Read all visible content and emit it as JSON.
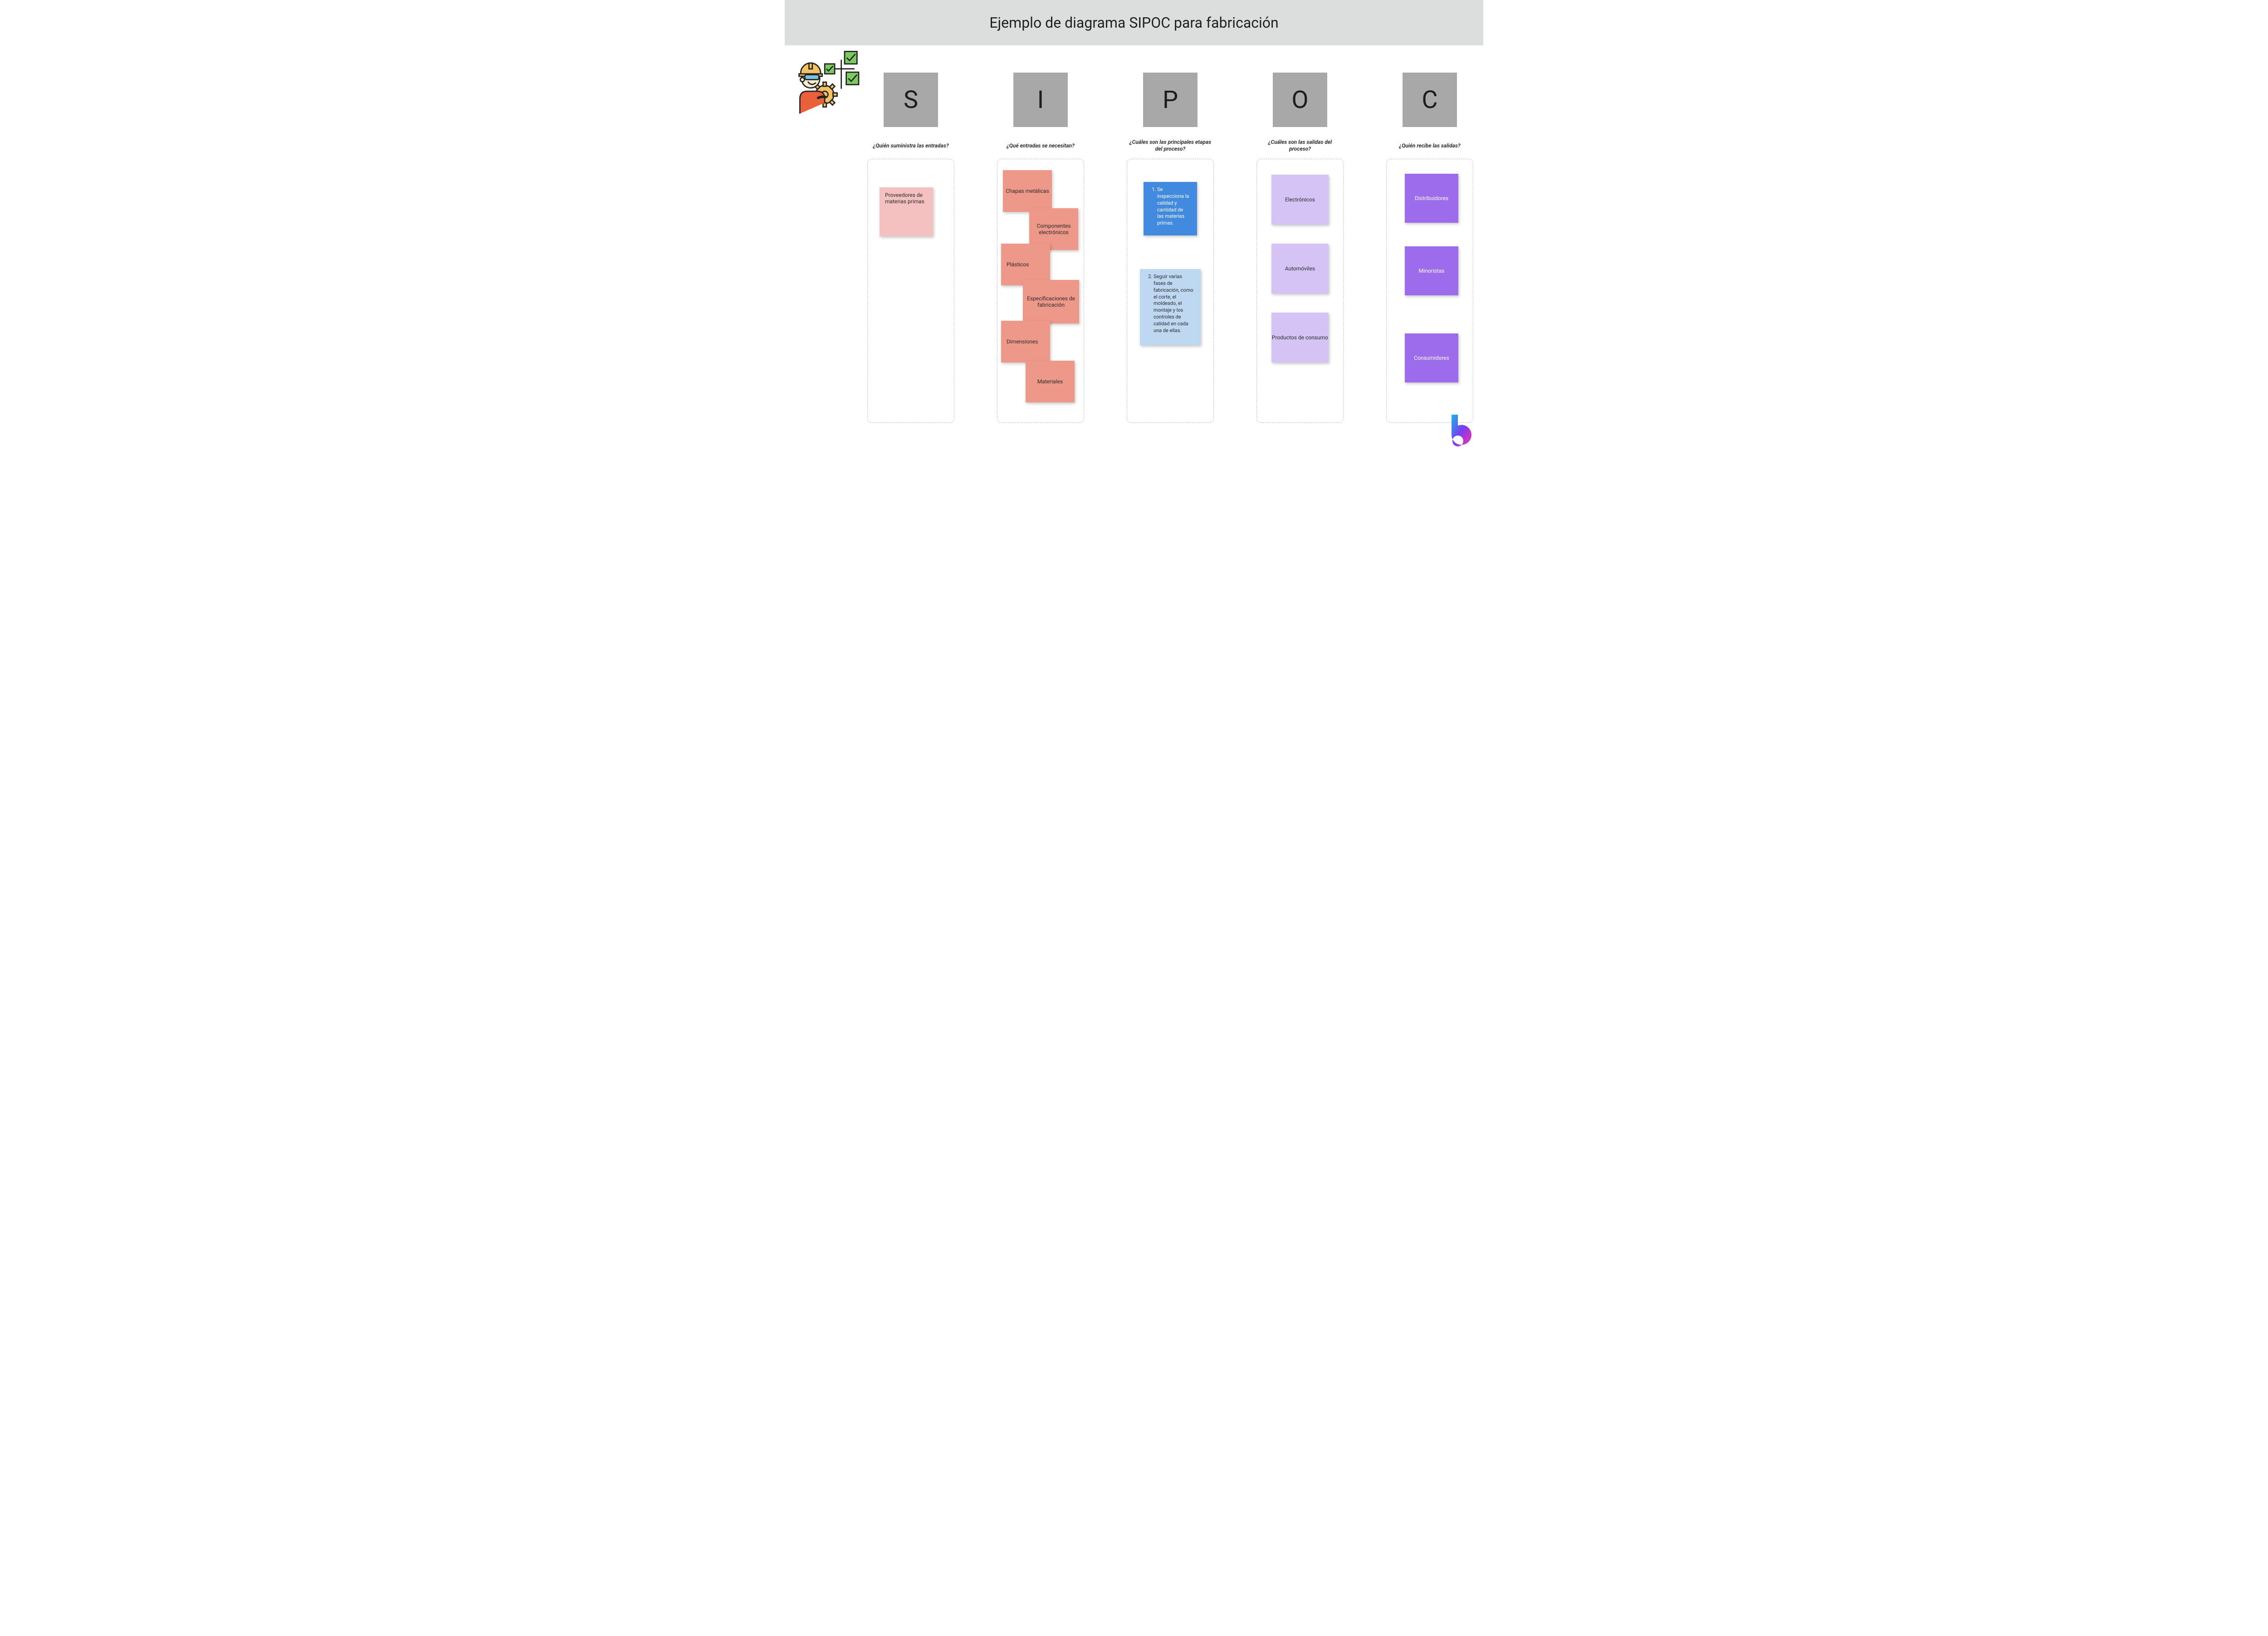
{
  "title": "Ejemplo de diagrama SIPOC para fabricación",
  "columns": {
    "s": {
      "letter": "S",
      "question": "¿Quién suministra las entradas?",
      "notes": {
        "suppliers": "Proveedores de materias primas"
      }
    },
    "i": {
      "letter": "I",
      "question": "¿Qué entradas se necesitan?",
      "notes": {
        "n1": "Chapas metálicas",
        "n2": "Componentes electrónicos",
        "n3": "Plásticos",
        "n4": "Especificaciones de fabricación",
        "n5": "Dimensiones",
        "n6": "Materiales"
      }
    },
    "p": {
      "letter": "P",
      "question": "¿Cuáles son las principales etapas del proceso?",
      "notes": {
        "step1": "Se inspecciona la calidad y cantidad de las materias primas.",
        "step2": "Seguir varias fases de fabricación, como el corte, el moldeado, el montaje y los controles de calidad en cada una de ellas."
      }
    },
    "o": {
      "letter": "O",
      "question": "¿Cuáles son las salidas del proceso?",
      "notes": {
        "n1": "Electrónicos",
        "n2": "Automóviles",
        "n3": "Productos de consumo"
      }
    },
    "c": {
      "letter": "C",
      "question": "¿Quién recibe las salidas?",
      "notes": {
        "n1": "Distribuidores",
        "n2": "Minoristas",
        "n3": "Consumidores"
      }
    }
  }
}
